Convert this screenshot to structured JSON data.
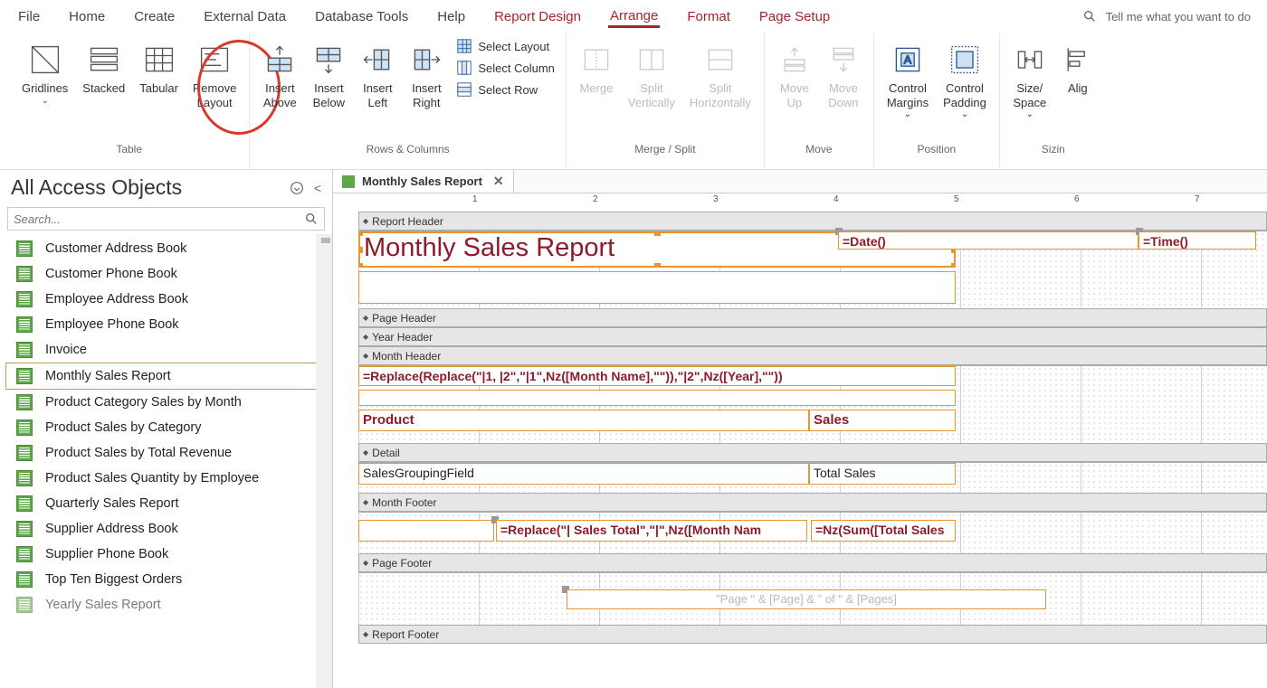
{
  "menu": {
    "items": [
      "File",
      "Home",
      "Create",
      "External Data",
      "Database Tools",
      "Help",
      "Report Design",
      "Arrange",
      "Format",
      "Page Setup"
    ],
    "active": 7,
    "redStart": 6,
    "tellme_placeholder": "Tell me what you want to do"
  },
  "ribbon": {
    "table": {
      "label": "Table",
      "gridlines": "Gridlines",
      "stacked": "Stacked",
      "tabular": "Tabular",
      "remove": "Remove\nLayout"
    },
    "rows": {
      "label": "Rows & Columns",
      "ia": "Insert\nAbove",
      "ib": "Insert\nBelow",
      "il": "Insert\nLeft",
      "ir": "Insert\nRight",
      "sl": "Select Layout",
      "sc": "Select Column",
      "sr": "Select Row"
    },
    "merge": {
      "label": "Merge / Split",
      "merge": "Merge",
      "sv": "Split\nVertically",
      "sh": "Split\nHorizontally"
    },
    "move": {
      "label": "Move",
      "up": "Move\nUp",
      "down": "Move\nDown"
    },
    "pos": {
      "label": "Position",
      "cm": "Control\nMargins",
      "cp": "Control\nPadding"
    },
    "size": {
      "label": "Sizin",
      "ss": "Size/\nSpace",
      "al": "Alig"
    }
  },
  "nav": {
    "title": "All Access Objects",
    "search_placeholder": "Search...",
    "items": [
      "Customer Address Book",
      "Customer Phone Book",
      "Employee Address Book",
      "Employee Phone Book",
      "Invoice",
      "Monthly Sales Report",
      "Product Category Sales by Month",
      "Product Sales by Category",
      "Product Sales by Total Revenue",
      "Product Sales Quantity by Employee",
      "Quarterly Sales Report",
      "Supplier Address Book",
      "Supplier Phone Book",
      "Top Ten Biggest Orders",
      "Yearly Sales Report"
    ],
    "selected": 5
  },
  "tab": {
    "label": "Monthly Sales Report"
  },
  "sections": {
    "rh": "Report Header",
    "ph": "Page Header",
    "yh": "Year Header",
    "mh": "Month Header",
    "det": "Detail",
    "mf": "Month Footer",
    "pf": "Page Footer",
    "rf": "Report Footer"
  },
  "fields": {
    "title": "Monthly Sales Report",
    "date": "=Date()",
    "time": "=Time()",
    "month_formula": "=Replace(Replace(\"|1, |2\",\"|1\",Nz([Month Name],\"\")),\"|2\",Nz([Year],\"\"))",
    "product": "Product",
    "sales": "Sales",
    "grouping": "SalesGroupingField",
    "total": "Total Sales",
    "mf_replace": "=Replace(\"| Sales Total\",\"|\",Nz([Month Nam",
    "mf_sum": "=Nz(Sum([Total Sales",
    "pager": "\"Page \" & [Page] & \" of \" & [Pages]"
  },
  "ruler": [
    "1",
    "2",
    "3",
    "4",
    "5",
    "6",
    "7"
  ]
}
